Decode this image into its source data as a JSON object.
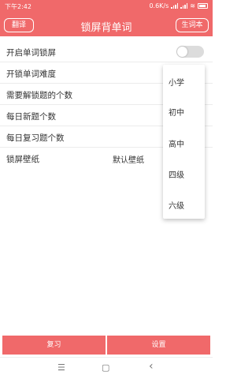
{
  "status_bar": {
    "time": "下午2:42",
    "speed": "0.6K/s"
  },
  "header": {
    "title": "锁屏背单词",
    "left_button": "翻译",
    "right_button": "生词本"
  },
  "settings": [
    {
      "label": "开启单词锁屏"
    },
    {
      "label": "开锁单词难度"
    },
    {
      "label": "需要解锁题的个数"
    },
    {
      "label": "每日新题个数"
    },
    {
      "label": "每日复习题个数"
    },
    {
      "label": "锁屏壁纸",
      "value": "默认壁纸"
    }
  ],
  "toggle": {
    "state": "off"
  },
  "difficulty_options": [
    "小学",
    "初中",
    "高中",
    "四级",
    "六级"
  ],
  "bottom_buttons": {
    "review": "复习",
    "settings": "设置"
  },
  "nav": {
    "menu": "☰",
    "home": "▢",
    "back": "‹"
  },
  "colors": {
    "accent": "#f0696a"
  }
}
